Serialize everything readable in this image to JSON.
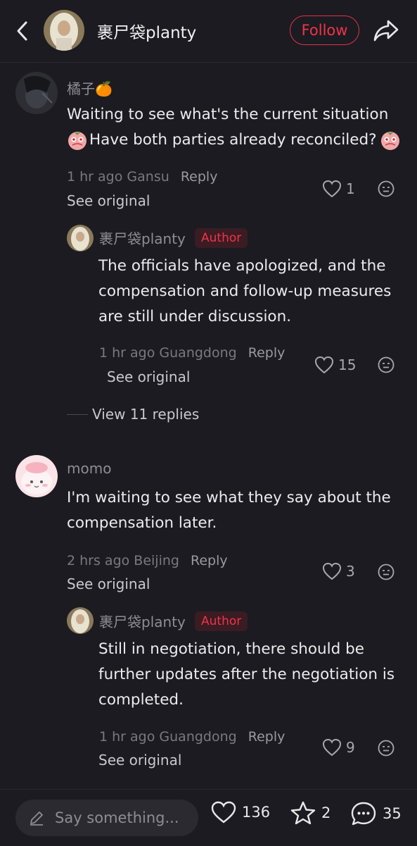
{
  "header": {
    "username": "裹尸袋planty",
    "follow_label": "Follow"
  },
  "comments": [
    {
      "username": "橘子🍊",
      "text_line1": "Waiting to see what's the current situation",
      "text_line2": "Have both parties already reconciled?",
      "time": "1 hr ago",
      "location": "Gansu",
      "reply_label": "Reply",
      "see_original": "See original",
      "likes": "1",
      "reply": {
        "username": "裹尸袋planty",
        "badge": "Author",
        "text_lines": [
          "The officials have apologized, and the",
          "compensation and follow-up measures",
          "are still under discussion."
        ],
        "time": "1 hr ago",
        "location": "Guangdong",
        "reply_label": "Reply",
        "see_original": "See original",
        "likes": "15"
      },
      "view_replies": "View 11 replies"
    },
    {
      "username": "momo",
      "text_lines": [
        "I'm waiting to see what they say about the",
        "compensation later."
      ],
      "time": "2 hrs ago",
      "location": "Beijing",
      "reply_label": "Reply",
      "see_original": "See original",
      "likes": "3",
      "reply": {
        "username": "裹尸袋planty",
        "badge": "Author",
        "text_lines": [
          "Still in negotiation, there should be",
          "further updates after the negotiation is",
          "completed."
        ],
        "time": "1 hr ago",
        "location": "Guangdong",
        "reply_label": "Reply",
        "see_original": "See original",
        "likes": "9"
      }
    }
  ],
  "bottom_bar": {
    "placeholder": "Say something...",
    "likes": "136",
    "stars": "2",
    "comments": "35"
  },
  "colors": {
    "background": "#1c1b21",
    "accent": "#f0334a"
  }
}
